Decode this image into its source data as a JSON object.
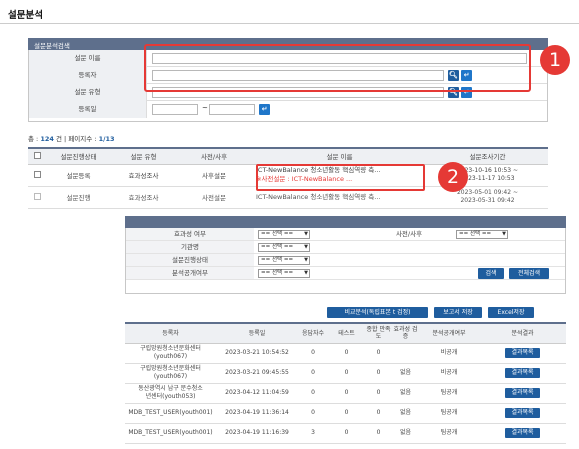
{
  "page": {
    "title": "설문분석"
  },
  "search_panel": {
    "title": "설문분석검색",
    "fields": [
      {
        "label": "설문 이름",
        "value": ""
      },
      {
        "label": "등록자",
        "value": ""
      },
      {
        "label": "설문 유형",
        "value": ""
      },
      {
        "label": "등록일",
        "from": "",
        "to": "",
        "separator": "~"
      }
    ]
  },
  "summary": {
    "total_prefix": "총 : ",
    "total": "124",
    "total_unit": "건",
    "divider": "|",
    "page_prefix": "페이지수 : ",
    "page": "1/13"
  },
  "survey_table": {
    "headers": [
      "설문진행상태",
      "설문 유형",
      "사전/사후",
      "설문 이름",
      "설문조사기간"
    ],
    "rows": [
      {
        "status": "설문등록",
        "type": "효과성조사",
        "prepost": "사후설문",
        "name": "ICT-NewBalance 청소년활동 핵심역량 측...",
        "name2": "※사전설문 : ICT-NewBalance ...",
        "period": "2023-10-16 10:53 ~",
        "period2": "2023-11-17 10:53"
      },
      {
        "status": "설문진행",
        "type": "효과성조사",
        "prepost": "사전설문",
        "name": "ICT-NewBalance 청소년활동 핵심역량 측...",
        "name2": "",
        "period": "2023-05-01 09:42 ~",
        "period2": "2023-05-31 09:42"
      }
    ]
  },
  "filter_panel": {
    "rows": [
      {
        "label": "효과성 여부",
        "select": "== 선택 ==",
        "label2": "사전/사후",
        "select2": "== 선택 =="
      },
      {
        "label": "기관명",
        "select": "== 선택 =="
      },
      {
        "label": "설문진행상태",
        "select": "== 선택 =="
      },
      {
        "label": "분석공개여부",
        "select": "== 선택 =="
      }
    ],
    "search_button": "검색",
    "reset_button": "전체검색"
  },
  "actions": {
    "compare": "비교분석(독립표본 t 검정)",
    "report": "보고서 저장",
    "excel": "Excel저장"
  },
  "result_table": {
    "headers": [
      "등록자",
      "등록일",
      "응답자수",
      "테스트",
      "종합 만족도",
      "효과성 검증",
      "분석공개여부",
      "분석결과"
    ],
    "rows": [
      {
        "user": "구립망원청소년문화센터",
        "user2": "(youth067)",
        "date": "2023-03-21 10:54:52",
        "respondents": "0",
        "test": "0",
        "satisfaction": "0",
        "effect": "",
        "public": "비공개",
        "result": "결과목록"
      },
      {
        "user": "구립망원청소년문화센터",
        "user2": "(youth067)",
        "date": "2023-03-21 09:45:55",
        "respondents": "0",
        "test": "0",
        "satisfaction": "0",
        "effect": "없음",
        "public": "비공개",
        "result": "결과목록"
      },
      {
        "user": "동산광역시 남구 문수청소",
        "user2": "년센터(youth053)",
        "date": "2023-04-12 11:04:59",
        "respondents": "0",
        "test": "0",
        "satisfaction": "0",
        "effect": "없음",
        "public": "팀공개",
        "result": "결과목록"
      },
      {
        "user": "MDB_TEST_USER(youth001)",
        "user2": "",
        "date": "2023-04-19 11:36:14",
        "respondents": "0",
        "test": "0",
        "satisfaction": "0",
        "effect": "없음",
        "public": "팀공개",
        "result": "결과목록"
      },
      {
        "user": "MDB_TEST_USER(youth001)",
        "user2": "",
        "date": "2023-04-19 11:16:39",
        "respondents": "3",
        "test": "0",
        "satisfaction": "0",
        "effect": "없음",
        "public": "팀공개",
        "result": "결과목록"
      }
    ]
  },
  "annotations": {
    "marker1": "1",
    "marker2": "2"
  },
  "colors": {
    "accent": "#1f5d9e",
    "header": "#5e6f8c",
    "highlight": "#e53935"
  }
}
